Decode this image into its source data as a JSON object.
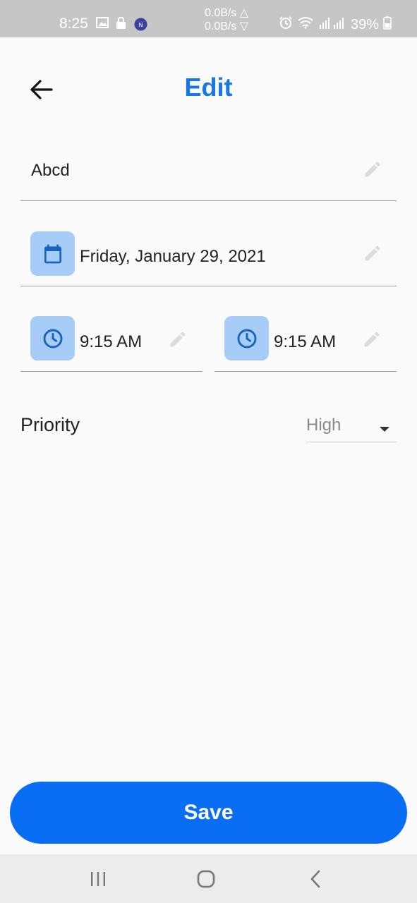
{
  "status_bar": {
    "time": "8:25",
    "net_up": "0.0B/s △",
    "net_down": "0.0B/s ▽",
    "battery": "39%"
  },
  "header": {
    "title": "Edit"
  },
  "form": {
    "name_value": "Abcd",
    "date_value": "Friday, January 29, 2021",
    "start_time": "9:15 AM",
    "end_time": "9:15 AM",
    "priority_label": "Priority",
    "priority_value": "High"
  },
  "save_label": "Save",
  "colors": {
    "accent": "#1976e8",
    "button": "#0a6ef5",
    "icon_bg": "#a8ccf8",
    "icon_fg": "#1565c0"
  }
}
